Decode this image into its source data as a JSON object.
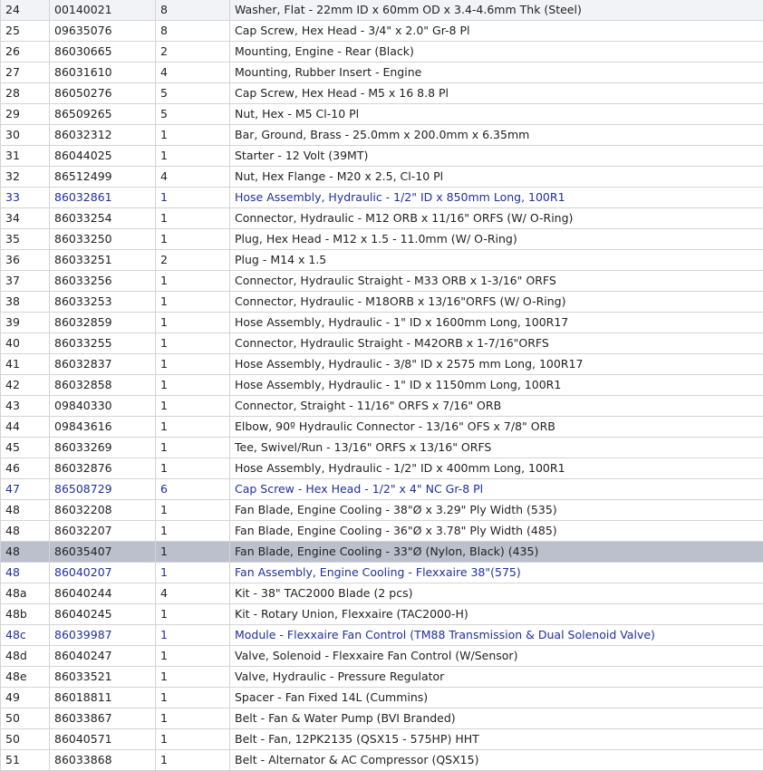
{
  "rows": [
    {
      "item": "24",
      "part": "00140021",
      "qty": "8",
      "desc": "Washer, Flat - 22mm ID x 60mm OD x 3.4-4.6mm Thk (Steel)",
      "link": false
    },
    {
      "item": "25",
      "part": "09635076",
      "qty": "8",
      "desc": "Cap Screw, Hex Head - 3/4\" x 2.0\" Gr-8 Pl",
      "link": false
    },
    {
      "item": "26",
      "part": "86030665",
      "qty": "2",
      "desc": "Mounting, Engine - Rear (Black)",
      "link": false
    },
    {
      "item": "27",
      "part": "86031610",
      "qty": "4",
      "desc": "Mounting, Rubber Insert - Engine",
      "link": false
    },
    {
      "item": "28",
      "part": "86050276",
      "qty": "5",
      "desc": "Cap Screw, Hex Head - M5 x 16 8.8 Pl",
      "link": false
    },
    {
      "item": "29",
      "part": "86509265",
      "qty": "5",
      "desc": "Nut, Hex - M5 Cl-10 Pl",
      "link": false
    },
    {
      "item": "30",
      "part": "86032312",
      "qty": "1",
      "desc": "Bar, Ground, Brass - 25.0mm x 200.0mm x 6.35mm",
      "link": false
    },
    {
      "item": "31",
      "part": "86044025",
      "qty": "1",
      "desc": "Starter - 12 Volt (39MT)",
      "link": false
    },
    {
      "item": "32",
      "part": "86512499",
      "qty": "4",
      "desc": "Nut, Hex Flange - M20 x 2.5, Cl-10 Pl",
      "link": false
    },
    {
      "item": "33",
      "part": "86032861",
      "qty": "1",
      "desc": "Hose Assembly, Hydraulic - 1/2\" ID x 850mm Long, 100R1",
      "link": true
    },
    {
      "item": "34",
      "part": "86033254",
      "qty": "1",
      "desc": "Connector, Hydraulic - M12 ORB x 11/16\" ORFS (W/ O-Ring)",
      "link": false
    },
    {
      "item": "35",
      "part": "86033250",
      "qty": "1",
      "desc": "Plug, Hex Head - M12 x 1.5 - 11.0mm (W/ O-Ring)",
      "link": false
    },
    {
      "item": "36",
      "part": "86033251",
      "qty": "2",
      "desc": "Plug - M14 x 1.5",
      "link": false
    },
    {
      "item": "37",
      "part": "86033256",
      "qty": "1",
      "desc": "Connector, Hydraulic Straight - M33 ORB x 1-3/16\" ORFS",
      "link": false
    },
    {
      "item": "38",
      "part": "86033253",
      "qty": "1",
      "desc": "Connector, Hydraulic - M18ORB x 13/16\"ORFS (W/ O-Ring)",
      "link": false
    },
    {
      "item": "39",
      "part": "86032859",
      "qty": "1",
      "desc": "Hose Assembly, Hydraulic - 1\" ID x 1600mm Long, 100R17",
      "link": false
    },
    {
      "item": "40",
      "part": "86033255",
      "qty": "1",
      "desc": "Connector, Hydraulic Straight - M42ORB x 1-7/16\"ORFS",
      "link": false
    },
    {
      "item": "41",
      "part": "86032837",
      "qty": "1",
      "desc": "Hose Assembly, Hydraulic - 3/8\" ID x 2575 mm Long, 100R17",
      "link": false
    },
    {
      "item": "42",
      "part": "86032858",
      "qty": "1",
      "desc": "Hose Assembly, Hydraulic - 1\" ID x 1150mm Long, 100R1",
      "link": false
    },
    {
      "item": "43",
      "part": "09840330",
      "qty": "1",
      "desc": "Connector, Straight - 11/16\" ORFS x 7/16\" ORB",
      "link": false
    },
    {
      "item": "44",
      "part": "09843616",
      "qty": "1",
      "desc": "Elbow, 90º Hydraulic Connector - 13/16\" OFS x 7/8\" ORB",
      "link": false
    },
    {
      "item": "45",
      "part": "86033269",
      "qty": "1",
      "desc": "Tee, Swivel/Run - 13/16\" ORFS x 13/16\" ORFS",
      "link": false
    },
    {
      "item": "46",
      "part": "86032876",
      "qty": "1",
      "desc": "Hose Assembly, Hydraulic - 1/2\" ID x 400mm Long, 100R1",
      "link": false
    },
    {
      "item": "47",
      "part": "86508729",
      "qty": "6",
      "desc": "Cap Screw - Hex Head - 1/2\" x 4\" NC Gr-8 Pl",
      "link": true
    },
    {
      "item": "48",
      "part": "86032208",
      "qty": "1",
      "desc": "Fan Blade, Engine Cooling - 38\"Ø x 3.29\" Ply Width (535)",
      "link": false
    },
    {
      "item": "48",
      "part": "86032207",
      "qty": "1",
      "desc": "Fan Blade, Engine Cooling - 36\"Ø x 3.78\" Ply Width (485)",
      "link": false
    },
    {
      "item": "48",
      "part": "86035407",
      "qty": "1",
      "desc": "Fan Blade, Engine Cooling - 33\"Ø (Nylon, Black) (435)",
      "link": false,
      "selected": true
    },
    {
      "item": "48",
      "part": "86040207",
      "qty": "1",
      "desc": "Fan Assembly, Engine Cooling - Flexxaire 38\"(575)",
      "link": true
    },
    {
      "item": "48a",
      "part": "86040244",
      "qty": "4",
      "desc": "Kit - 38\" TAC2000 Blade (2 pcs)",
      "link": false
    },
    {
      "item": "48b",
      "part": "86040245",
      "qty": "1",
      "desc": "Kit - Rotary Union, Flexxaire (TAC2000-H)",
      "link": false
    },
    {
      "item": "48c",
      "part": "86039987",
      "qty": "1",
      "desc": "Module - Flexxaire Fan Control (TM88 Transmission & Dual Solenoid Valve)",
      "link": true
    },
    {
      "item": "48d",
      "part": "86040247",
      "qty": "1",
      "desc": "Valve, Solenoid - Flexxaire Fan Control (W/Sensor)",
      "link": false
    },
    {
      "item": "48e",
      "part": "86033521",
      "qty": "1",
      "desc": "Valve, Hydraulic - Pressure Regulator",
      "link": false
    },
    {
      "item": "49",
      "part": "86018811",
      "qty": "1",
      "desc": "Spacer - Fan Fixed 14L (Cummins)",
      "link": false
    },
    {
      "item": "50",
      "part": "86033867",
      "qty": "1",
      "desc": "Belt - Fan & Water Pump (BVI Branded)",
      "link": false
    },
    {
      "item": "50",
      "part": "86040571",
      "qty": "1",
      "desc": "Belt - Fan, 12PK2135 (QSX15 - 575HP) HHT",
      "link": false
    },
    {
      "item": "51",
      "part": "86033868",
      "qty": "1",
      "desc": "Belt - Alternator & AC Compressor (QSX15)",
      "link": false
    }
  ]
}
